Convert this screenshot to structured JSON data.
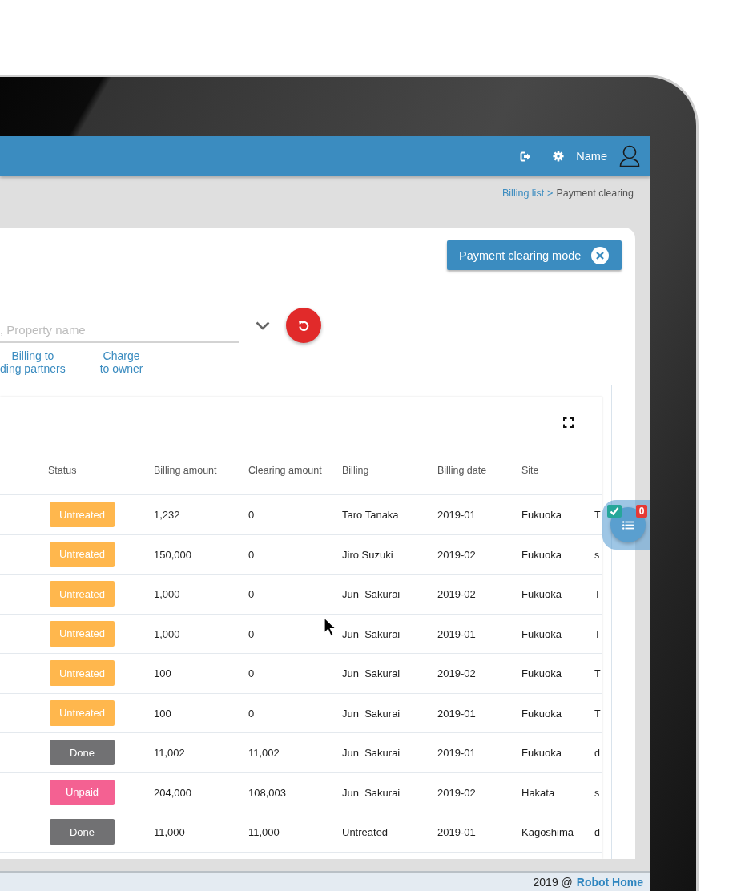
{
  "header": {
    "user_name": "Name"
  },
  "breadcrumb": {
    "items": [
      {
        "label": "Billing list",
        "kind": "link"
      },
      {
        "label": "Payment clearing",
        "kind": "current"
      }
    ],
    "separator": ">"
  },
  "mode_button": {
    "label": "Payment clearing mode"
  },
  "search": {
    "placeholder": ", Property name"
  },
  "filter_links": [
    "Billing to\nding partners",
    "Charge\nto owner"
  ],
  "table": {
    "columns": [
      "Status",
      "Billing amount",
      "Clearing amount",
      "Billing",
      "Billing date",
      "Site"
    ],
    "rows": [
      {
        "status": {
          "label": "Untreated",
          "color": "#ffb74d"
        },
        "billing_amount": "1,232",
        "clearing_amount": "0",
        "billing": "Taro Tanaka",
        "billing_date": "2019-01",
        "site": "Fukuoka",
        "column_7": "T"
      },
      {
        "status": {
          "label": "Untreated",
          "color": "#ffb74d"
        },
        "billing_amount": "150,000",
        "clearing_amount": "0",
        "billing": "Jiro Suzuki",
        "billing_date": "2019-02",
        "site": "Fukuoka",
        "column_7": "s"
      },
      {
        "status": {
          "label": "Untreated",
          "color": "#ffb74d"
        },
        "billing_amount": "1,000",
        "clearing_amount": "0",
        "billing": "Jun  Sakurai",
        "billing_date": "2019-02",
        "site": "Fukuoka",
        "column_7": "T"
      },
      {
        "status": {
          "label": "Untreated",
          "color": "#ffb74d"
        },
        "billing_amount": "1,000",
        "clearing_amount": "0",
        "billing": "Jun  Sakurai",
        "billing_date": "2019-01",
        "site": "Fukuoka",
        "column_7": "T"
      },
      {
        "status": {
          "label": "Untreated",
          "color": "#ffb74d"
        },
        "billing_amount": "100",
        "clearing_amount": "0",
        "billing": "Jun  Sakurai",
        "billing_date": "2019-02",
        "site": "Fukuoka",
        "column_7": "T"
      },
      {
        "status": {
          "label": "Untreated",
          "color": "#ffb74d"
        },
        "billing_amount": "100",
        "clearing_amount": "0",
        "billing": "Jun  Sakurai",
        "billing_date": "2019-01",
        "site": "Fukuoka",
        "column_7": "T"
      },
      {
        "status": {
          "label": "Done",
          "color": "#717173"
        },
        "billing_amount": "11,002",
        "clearing_amount": "11,002",
        "billing": "Jun  Sakurai",
        "billing_date": "2019-01",
        "site": "Fukuoka",
        "column_7": "d"
      },
      {
        "status": {
          "label": "Unpaid",
          "color": "#f46192"
        },
        "billing_amount": "204,000",
        "clearing_amount": "108,003",
        "billing": "Jun  Sakurai",
        "billing_date": "2019-02",
        "site": "Hakata",
        "column_7": "s"
      },
      {
        "status": {
          "label": "Done",
          "color": "#717173"
        },
        "billing_amount": "11,000",
        "clearing_amount": "11,000",
        "billing": "Untreated",
        "billing_date": "2019-01",
        "site": "Kagoshima",
        "column_7": "d"
      }
    ]
  },
  "floating_widget": {
    "count": "0"
  },
  "footer": {
    "copyright": "2019 @",
    "company": "Robot Home"
  }
}
